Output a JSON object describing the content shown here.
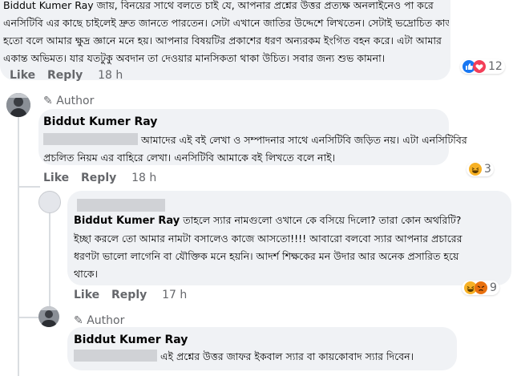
{
  "comment_top": {
    "lines": [
      "Biddut Kumer Ray জায়, বিনয়ের সাথে বলতে চাই যে, আপনার প্রশ্নের উত্তর প্রত্যক্ষ অনলাইনেও পা করে",
      "এনসিটিবি এর কাছে চাইলেই দ্রুত জানতে পারতেন। সেটা এখানে জাতির উদ্দেশে লিখতেন। সেটাই ভদ্রোচিত কাজ",
      "হতো বলে আমার ক্ষুদ্র জ্ঞানে মনে হয়। আপনার বিষয়টির প্রকাশের ধরণ অন্যরকম ইংগিত বহন করে। এটা আমার",
      "একান্ত অভিমত। যার যতটুকু অবদান তা দেওয়ার মানসিকতা থাকা উচিত। সবার জন্য শুভ কামনা।"
    ],
    "like": "Like",
    "reply": "Reply",
    "time": "18 h",
    "reactions_count": "12"
  },
  "comment_author_1": {
    "author_tag": "Author",
    "name": "Biddut Kumer Ray",
    "line1_after_redact": "আমাদের এই বই লেখা ও সম্পাদনার সাথে এনসিটিবি জড়িত নয়। এটা এনসিটিবির",
    "line2": "প্রচলিত নিয়ম এর বাহিরে লেখা। এনসিটিবি আমাকে বই লিখতে বলে নাই।",
    "like": "Like",
    "reply": "Reply",
    "time": "18 h",
    "reactions_count": "3"
  },
  "comment_reply_2": {
    "name": "Biddut Kumer Ray",
    "line1_after_name": "তাহলে স্যার নামগুলো ওখানে কে বসিয়ে দিলো? তারা কোন অথরিটি?",
    "line2": "ইচ্ছা করলে তো আমার নামটা বসালেও কাজে আসতো!!!! আবারো বলবো স্যার আপনার প্রচারের",
    "line3": "ধরণটা ভালো লাগেনি বা যৌক্তিক মনে হয়নি। আদর্শ শিক্ষকের মন উদার আর অনেক প্রসারিত হয়ে",
    "line4": "থাকে।",
    "like": "Like",
    "reply": "Reply",
    "time": "17 h",
    "reactions_count": "9"
  },
  "comment_author_3": {
    "author_tag": "Author",
    "name": "Biddut Kumer Ray",
    "line1_after_redact": "এই প্রশ্নের উত্তর জাফর ইকবাল স্যার বা কায়কোবাদ স্যার দিবেন।"
  },
  "colors": {
    "bubble": "#f0f2f5",
    "meta": "#65676b",
    "like_blue": "#1877f2",
    "love_red": "#f33e58",
    "haha_yellow": "#f7b125"
  }
}
